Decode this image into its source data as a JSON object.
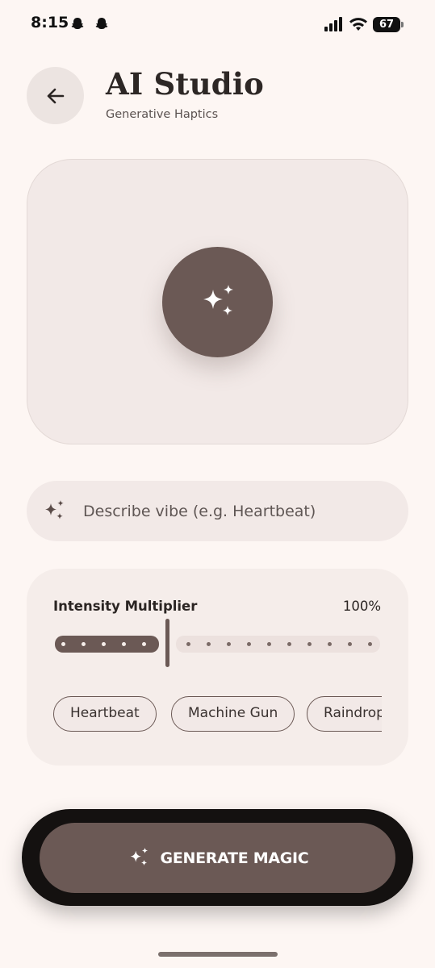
{
  "status_bar": {
    "time": "8:15",
    "battery_level": "67",
    "icons": [
      "snapchat-icon",
      "snapchat-icon",
      "signal-icon",
      "wifi-icon",
      "battery-icon"
    ]
  },
  "header": {
    "back_icon": "arrow-left-icon",
    "title": "AI Studio",
    "subtitle": "Generative Haptics"
  },
  "preview": {
    "icon": "sparkles-icon"
  },
  "vibe_input": {
    "icon": "sparkles-icon",
    "placeholder": "Describe vibe (e.g. Heartbeat)",
    "value": ""
  },
  "intensity": {
    "label": "Intensity Multiplier",
    "value_text": "100%",
    "fraction": 0.34
  },
  "presets": [
    {
      "label": "Heartbeat"
    },
    {
      "label": "Machine Gun"
    },
    {
      "label": "Raindrops"
    }
  ],
  "generate": {
    "icon": "sparkles-icon",
    "label": "GENERATE MAGIC"
  },
  "colors": {
    "background": "#fdf6f3",
    "accent": "#6b5955",
    "surface": "#f2e9e7",
    "dark": "#141110"
  }
}
